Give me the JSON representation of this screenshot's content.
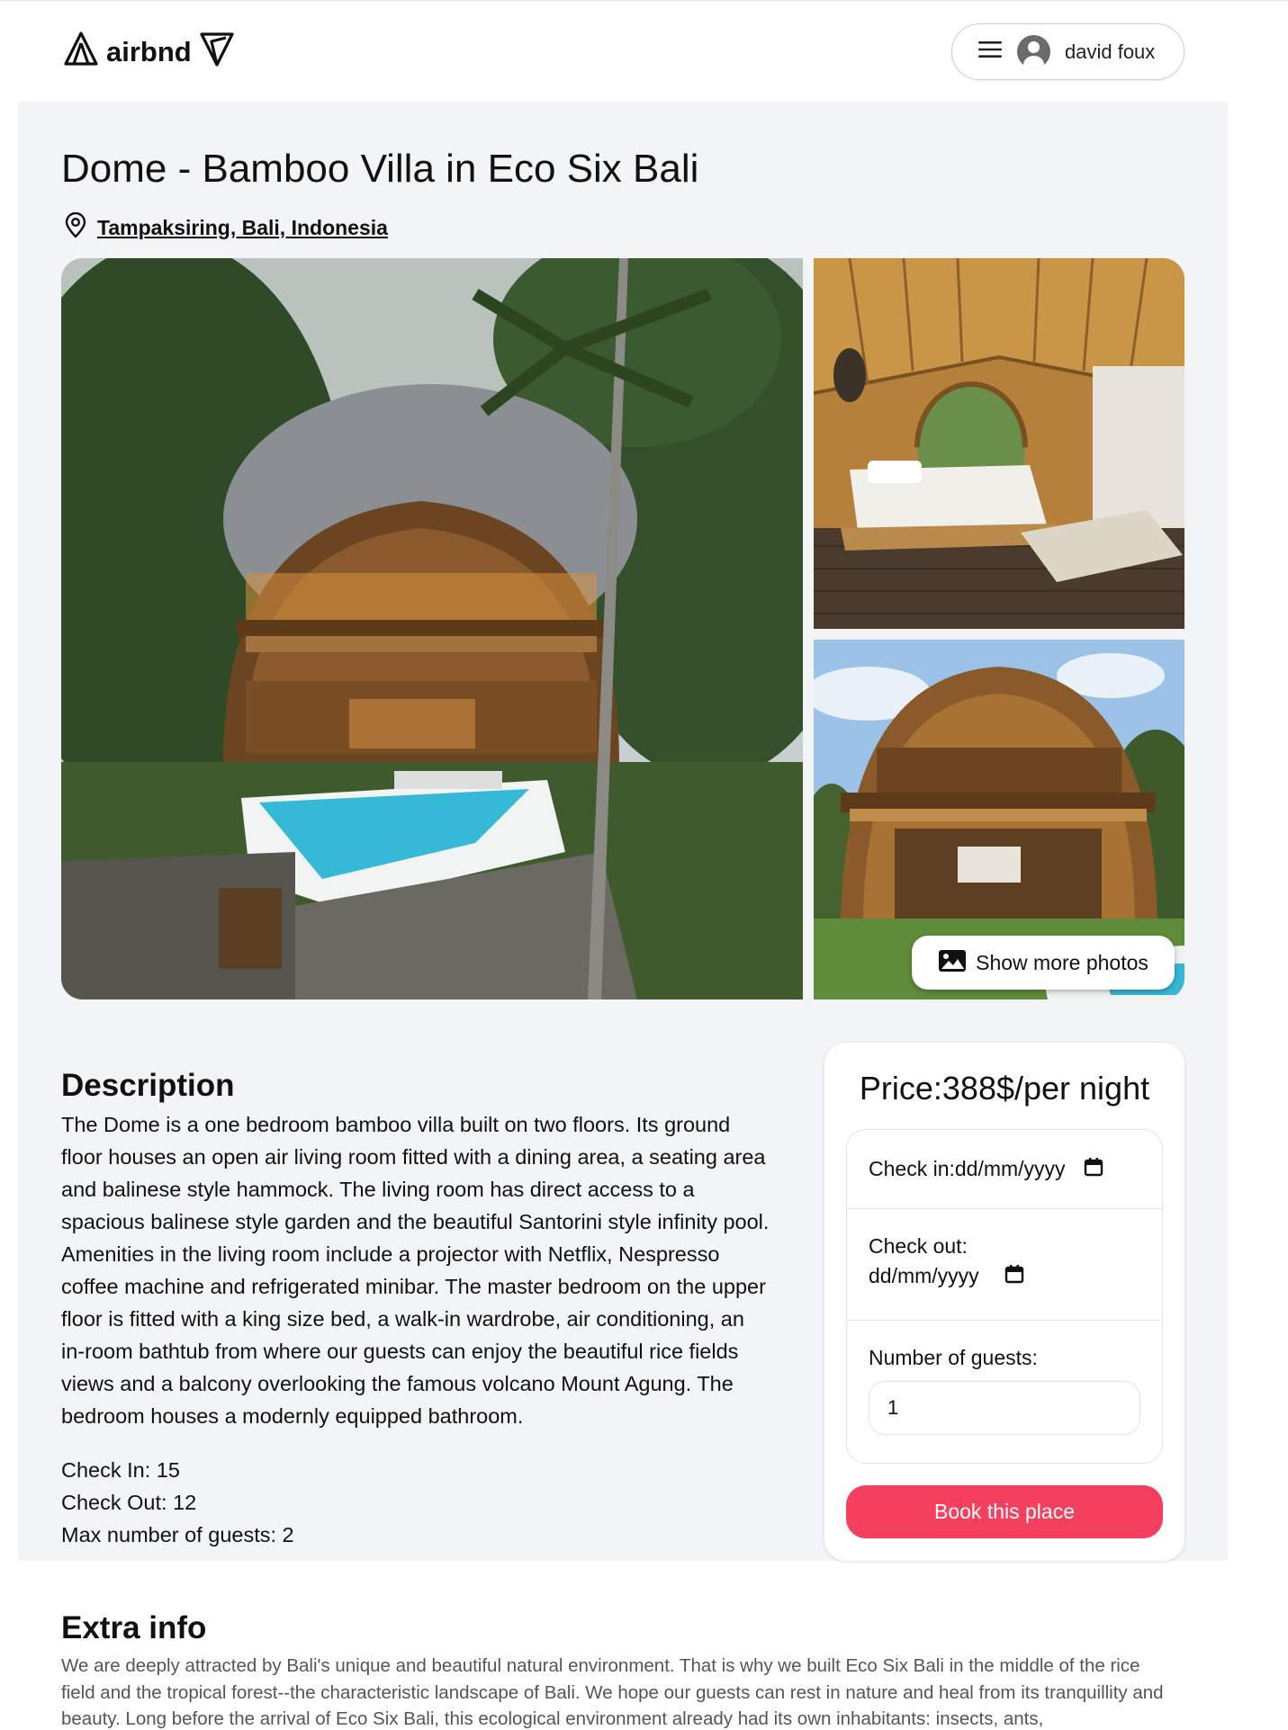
{
  "header": {
    "logo_text": "airbnd",
    "user_name": "david foux"
  },
  "listing": {
    "title": "Dome - Bamboo Villa in Eco Six Bali",
    "location": "Tampaksiring, Bali, Indonesia",
    "show_more_label": "Show more photos",
    "description_heading": "Description",
    "description": "The Dome is a one bedroom bamboo villa built on two floors. Its ground floor houses an open air living room fitted with a dining area, a seating area and balinese style hammock. The living room has direct access to a spacious balinese style garden and the beautiful Santorini style infinity pool. Amenities in the living room include a projector with Netflix, Nespresso coffee machine and refrigerated minibar. The master bedroom on the upper floor is fitted with a king size bed, a walk-in wardrobe, air conditioning, an in-room bathtub from where our guests can enjoy the beautiful rice fields views and a balcony overlooking the famous volcano Mount Agung. The bedroom houses a modernly equipped bathroom.",
    "check_in": "Check In: 15",
    "check_out": "Check Out: 12",
    "max_guests": "Max number of guests: 2"
  },
  "booking": {
    "price": "Price:388$/per night",
    "check_in_label": "Check in:",
    "check_in_value": "dd/mm/yyyy",
    "check_out_label": "Check out:",
    "check_out_value": "dd/mm/yyyy",
    "guests_label": "Number of guests:",
    "guests_value": "1",
    "book_button": "Book this place",
    "accent_color": "#f43f5e"
  },
  "extra": {
    "heading": "Extra info",
    "text": "We are deeply attracted by Bali's unique and beautiful natural environment. That is why we built Eco Six Bali in the middle of the rice field and the tropical forest--the characteristic landscape of Bali. We hope our guests can rest in nature and heal from its tranquillity and beauty. Long before the arrival of Eco Six Bali, this ecological environment already had its own inhabitants: insects, ants,"
  },
  "icons": {
    "logo_left": "airbnd-logo-icon",
    "logo_right": "v-logo-icon",
    "menu": "hamburger-icon",
    "avatar": "user-avatar-icon",
    "location": "map-pin-icon",
    "photos": "image-icon",
    "calendar": "calendar-icon"
  }
}
